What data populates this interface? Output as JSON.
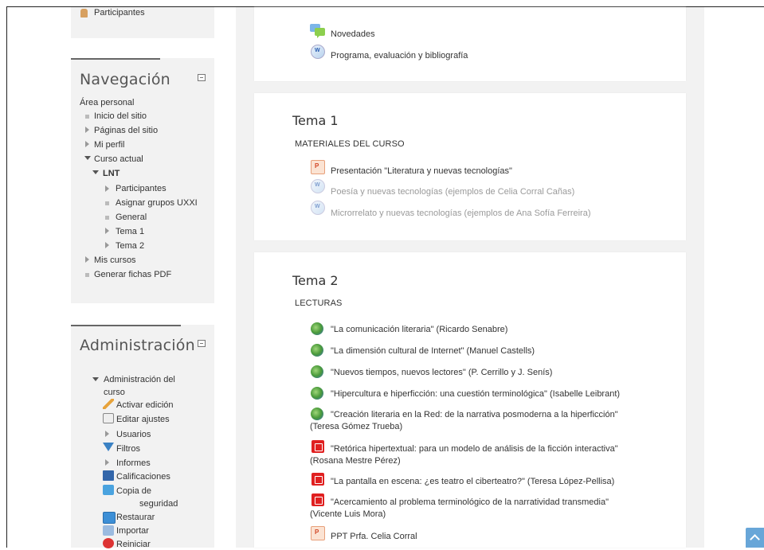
{
  "sidebar": {
    "top_partial": {
      "participantes": "Participantes"
    },
    "navegacion": {
      "title": "Navegación",
      "items": {
        "area_personal": "Área personal",
        "inicio": "Inicio del sitio",
        "paginas": "Páginas del sitio",
        "perfil": "Mi perfil",
        "curso_actual": "Curso actual",
        "lnt": "LNT",
        "participantes": "Participantes",
        "asignar": "Asignar grupos UXXI",
        "general": "General",
        "tema1": "Tema 1",
        "tema2": "Tema 2",
        "mis_cursos": "Mis cursos",
        "fichas": "Generar fichas PDF"
      }
    },
    "administracion": {
      "title": "Administración",
      "items": {
        "adm_curso_1": "Administración del",
        "adm_curso_2": "curso",
        "activar": "Activar edición",
        "editar": "Editar ajustes",
        "usuarios": "Usuarios",
        "filtros": "Filtros",
        "informes": "Informes",
        "calificaciones": "Calificaciones",
        "copia_1": "Copia de",
        "copia_2": "seguridad",
        "restaurar": "Restaurar",
        "importar": "Importar",
        "reiniciar": "Reiniciar"
      }
    }
  },
  "main": {
    "top_card": {
      "novedades": "Novedades",
      "programa": "Programa, evaluación y bibliografía"
    },
    "tema1": {
      "title": "Tema 1",
      "label": "MATERIALES DEL CURSO",
      "a1": "Presentación \"Literatura y nuevas tecnologías\"",
      "a2": "Poesía y nuevas tecnologías (ejemplos de Celia Corral Cañas)",
      "a3": "Microrrelato y nuevas tecnologías (ejemplos de Ana Sofía Ferreira)"
    },
    "tema2": {
      "title": "Tema 2",
      "label": "LECTURAS",
      "a1": "\"La comunicación literaria\" (Ricardo Senabre)",
      "a2": "\"La dimensión cultural de Internet\" (Manuel Castells)",
      "a3": "\"Nuevos tiempos, nuevos lectores\" (P. Cerrillo y J. Senís)",
      "a4": "\"Hipercultura e hiperficción: una cuestión terminológica\" (Isabelle Leibrant)",
      "a5_1": "\"Creación literaria en la Red: de la narrativa posmoderna a la hiperficción\"",
      "a5_2": "(Teresa Gómez Trueba)",
      "a6_1": "\"Retórica hipertextual: para un modelo de análisis de la ficción interactiva\"",
      "a6_2": "(Rosana Mestre Pérez)",
      "a7": "\"La pantalla en escena: ¿es teatro el ciberteatro?\" (Teresa López-Pellisa)",
      "a8_1": "\"Acercamiento al problema terminológico de la narratividad transmedia\"",
      "a8_2": "(Vicente Luis Mora)",
      "a9": "PPT Prfa. Celia Corral"
    }
  }
}
